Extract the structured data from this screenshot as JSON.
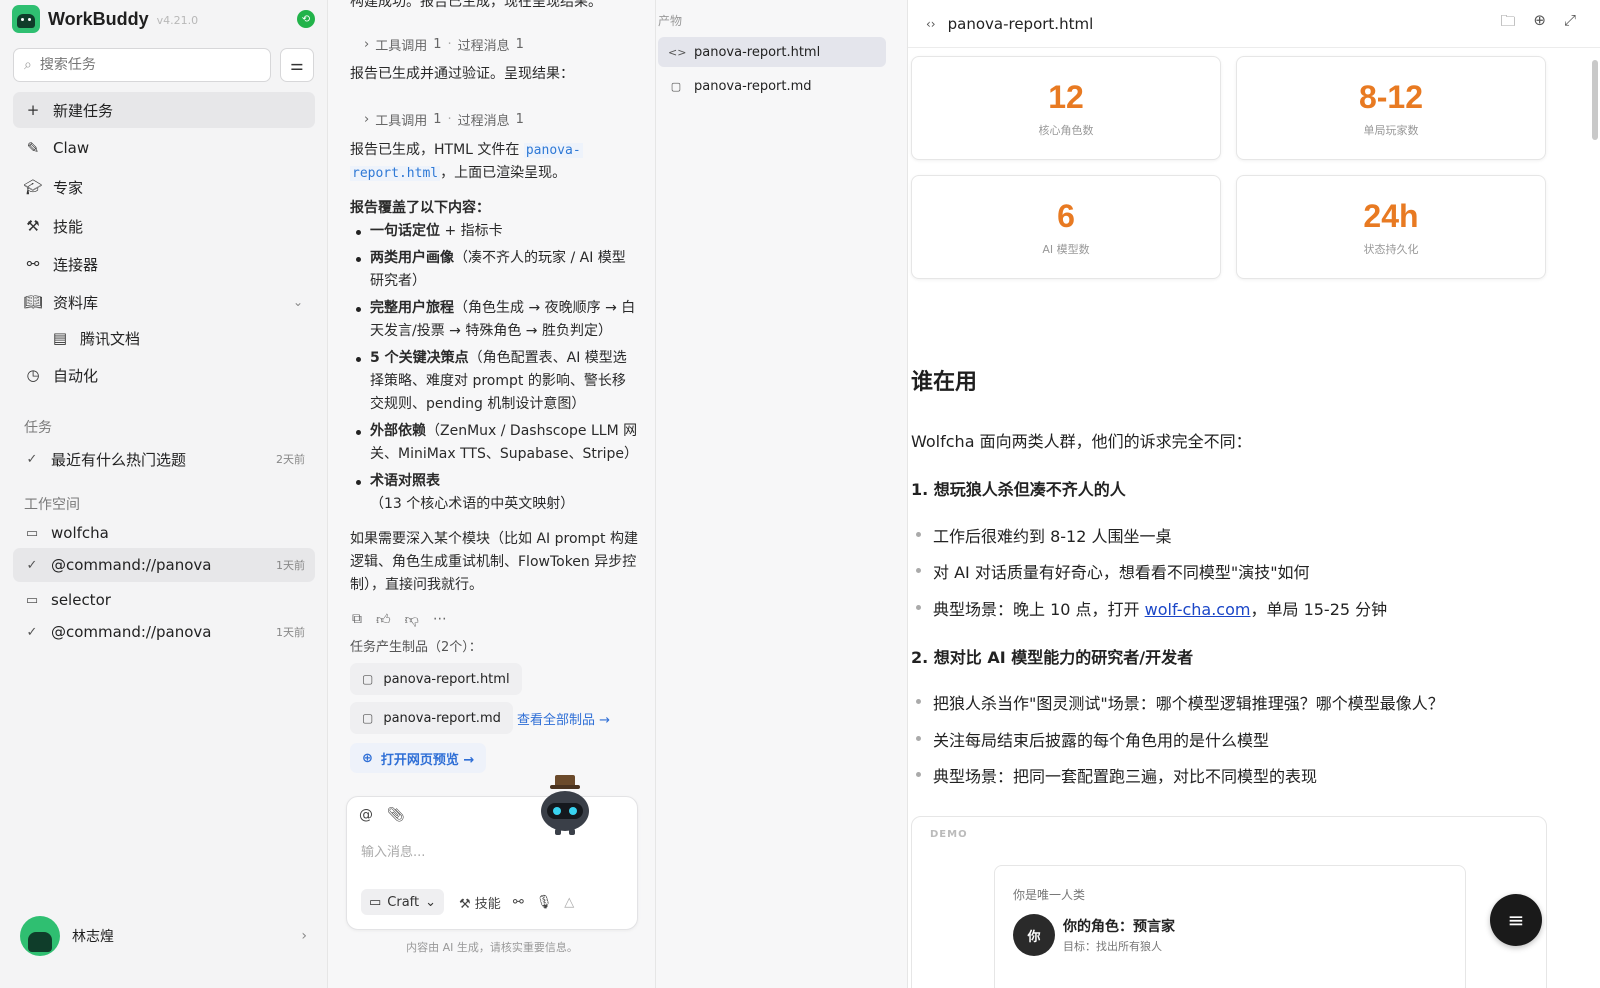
{
  "app": {
    "name": "WorkBuddy",
    "version": "v4.21.0"
  },
  "sidebar": {
    "search_placeholder": "搜索任务",
    "nav": [
      {
        "label": "新建任务",
        "icon": "plus-icon"
      },
      {
        "label": "Claw",
        "icon": "claw-icon"
      },
      {
        "label": "专家",
        "icon": "graduation-cap-icon"
      },
      {
        "label": "技能",
        "icon": "skill-icon"
      },
      {
        "label": "连接器",
        "icon": "connector-icon"
      },
      {
        "label": "资料库",
        "icon": "book-icon"
      },
      {
        "label": "腾讯文档",
        "icon": "tencent-docs-icon"
      },
      {
        "label": "自动化",
        "icon": "clock-icon"
      }
    ],
    "tasks_label": "任务",
    "tasks": [
      {
        "title": "最近有什么热门选题",
        "age": "2天前"
      }
    ],
    "workspace_label": "工作空间",
    "workspaces": [
      {
        "folder": "wolfcha",
        "task": "@command://panova",
        "age": "1天前"
      },
      {
        "folder": "selector",
        "task": "@command://panova",
        "age": "1天前"
      }
    ],
    "user_name": "林志煌"
  },
  "chat": {
    "top_line": "构建成功。报告已生成，现在呈现结果。",
    "tool_call_label": "工具调用",
    "tool_call_count": "1",
    "process_label": "过程消息",
    "process_count": "1",
    "msg1": "报告已生成并通过验证。呈现结果：",
    "msg2_pre": "报告已生成，HTML 文件在 ",
    "msg2_file1": "panova-",
    "msg2_file2": "report.html",
    "msg2_post": "，上面已渲染呈现。",
    "coverage_title": "报告覆盖了以下内容：",
    "bullets": [
      {
        "bold": "一句话定位",
        "rest": " + 指标卡"
      },
      {
        "bold": "两类用户画像",
        "rest": "（凑不齐人的玩家 / AI 模型研究者）"
      },
      {
        "bold": "完整用户旅程",
        "rest": "（角色生成 → 夜晚顺序 → 白天发言/投票 → 特殊角色 → 胜负判定）"
      },
      {
        "bold": "5 个关键决策点",
        "rest": "（角色配置表、AI 模型选择策略、难度对 prompt 的影响、警长移交规则、pending 机制设计意图）"
      },
      {
        "bold": "外部依赖",
        "rest": "（ZenMux / Dashscope LLM 网关、MiniMax TTS、Supabase、Stripe）"
      },
      {
        "bold": "术语对照表",
        "rest": "（13 个核心术语的中英文映射）"
      }
    ],
    "closing": "如果需要深入某个模块（比如 AI prompt 构建逻辑、角色生成重试机制、FlowToken 异步控制），直接问我就行。",
    "artifacts_label": "任务产生制品（2个）：",
    "file1": "panova-report.html",
    "file2": "panova-report.md",
    "view_all": "查看全部制品 →",
    "open_preview": "打开网页预览 →",
    "input_placeholder": "输入消息...",
    "mode": "Craft",
    "skill_label": "技能",
    "disclaimer": "内容由 AI 生成，请核实重要信息。"
  },
  "artifacts": {
    "title": "产物",
    "items": [
      "panova-report.html",
      "panova-report.md"
    ]
  },
  "preview": {
    "file_title": "panova-report.html",
    "stats": [
      {
        "value": "12",
        "label": "核心角色数"
      },
      {
        "value": "8-12",
        "label": "单局玩家数"
      },
      {
        "value": "6",
        "label": "AI 模型数"
      },
      {
        "value": "24h",
        "label": "状态持久化"
      }
    ],
    "h2": "谁在用",
    "intro": "Wolfcha 面向两类人群，他们的诉求完全不同：",
    "group1_title": "1. 想玩狼人杀但凑不齐人的人",
    "group1_items": [
      "工作后很难约到 8-12 人围坐一桌",
      "对 AI 对话质量有好奇心，想看看不同模型\"演技\"如何"
    ],
    "group1_scene_pre": "典型场景：晚上 10 点，打开 ",
    "group1_scene_link": "wolf-cha.com",
    "group1_scene_post": "，单局 15-25 分钟",
    "group2_title": "2. 想对比 AI 模型能力的研究者/开发者",
    "group2_items": [
      "把狼人杀当作\"图灵测试\"场景：哪个模型逻辑推理强？哪个模型最像人？",
      "关注每局结束后披露的每个角色用的是什么模型",
      "典型场景：把同一套配置跑三遍，对比不同模型的表现"
    ],
    "demo_tag": "DEMO",
    "demo_caption": "你是唯一人类",
    "demo_avatar": "你",
    "demo_role": "你的角色：预言家",
    "demo_goal": "目标：找出所有狼人"
  },
  "colors": {
    "accent_orange": "#e87a22",
    "link_blue": "#2f6fd6",
    "brand_green": "#2fbf71"
  }
}
